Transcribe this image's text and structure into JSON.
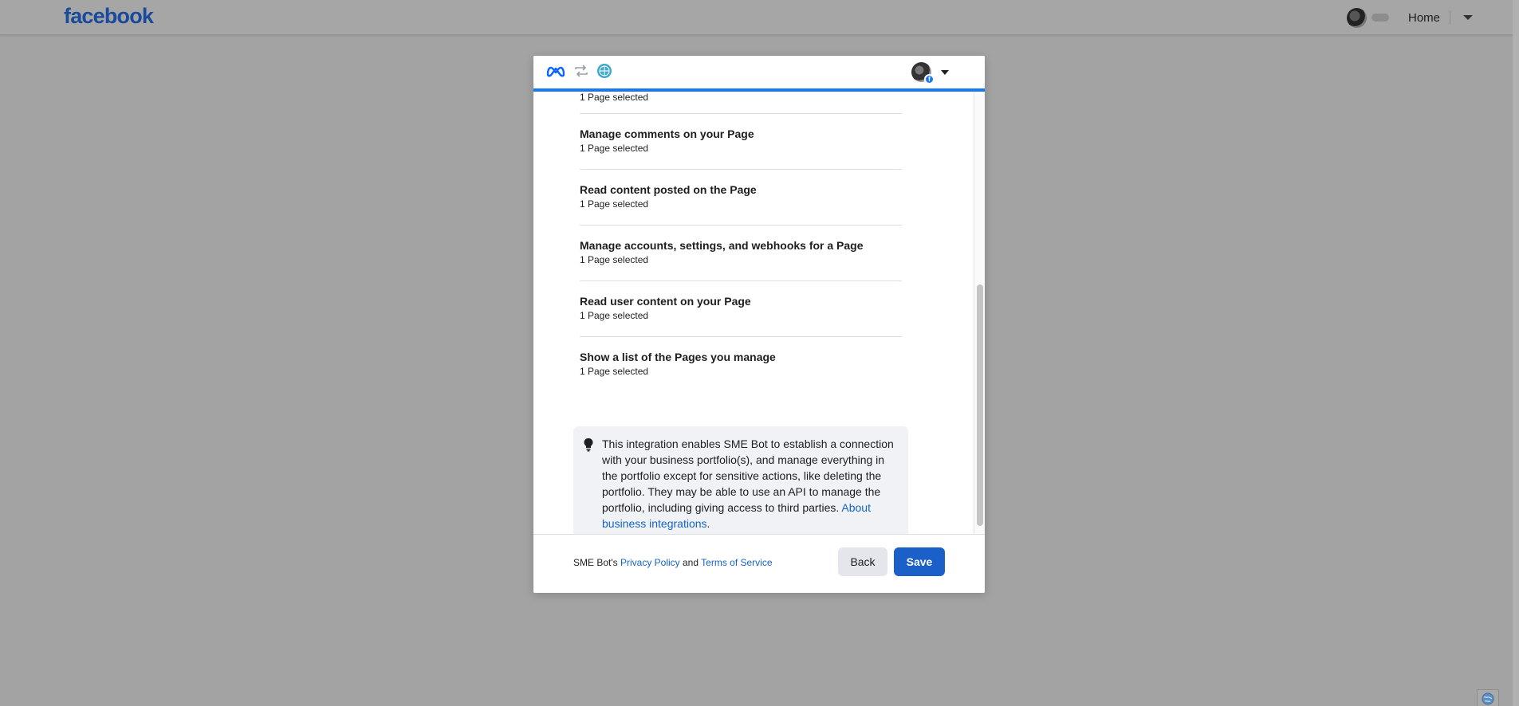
{
  "topbar": {
    "logo": "facebook",
    "home_label": "Home"
  },
  "dialog": {
    "permissions": [
      {
        "title": "",
        "subtitle": "1 Page selected"
      },
      {
        "title": "Manage comments on your Page",
        "subtitle": "1 Page selected"
      },
      {
        "title": "Read content posted on the Page",
        "subtitle": "1 Page selected"
      },
      {
        "title": "Manage accounts, settings, and webhooks for a Page",
        "subtitle": "1 Page selected"
      },
      {
        "title": "Read user content on your Page",
        "subtitle": "1 Page selected"
      },
      {
        "title": "Show a list of the Pages you manage",
        "subtitle": "1 Page selected"
      }
    ],
    "info": {
      "text": "This integration enables SME Bot to establish a connection with your business portfolio(s), and manage everything in the portfolio except for sensitive actions, like deleting the portfolio. They may be able to use an API to manage the portfolio, including giving access to third parties. ",
      "link": "About business integrations",
      "trailing": "."
    },
    "footer": {
      "prefix": "SME Bot's ",
      "privacy_link": "Privacy Policy",
      "and": " and ",
      "terms_link": "Terms of Service",
      "back_label": "Back",
      "save_label": "Save"
    }
  },
  "colors": {
    "accent": "#1877f2",
    "save_button": "#1b5fc9",
    "link": "#1463c7"
  }
}
